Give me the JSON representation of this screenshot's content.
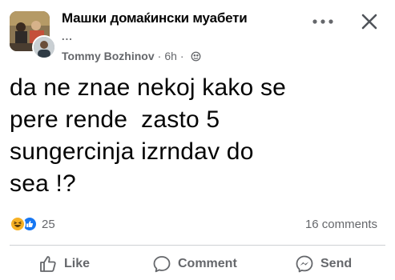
{
  "header": {
    "group_name": "Машки домаќински муабети",
    "group_name_overflow": "...",
    "author": "Tommy Bozhinov",
    "separator": "·",
    "time": "6h",
    "separator2": "·",
    "privacy_icon": "globe-icon",
    "more_icon": "more-icon",
    "close_icon": "close-icon"
  },
  "post": {
    "text": "da ne znae nekoj kako se\npere rende  zasto 5\nsungercinja izrndav do\nsea !?"
  },
  "engagement": {
    "reactions": [
      "haha-reaction-icon",
      "like-reaction-icon"
    ],
    "reaction_count": "25",
    "comments": "16 comments"
  },
  "actions": {
    "like": "Like",
    "comment": "Comment",
    "send": "Send"
  },
  "colors": {
    "text": "#050505",
    "secondary": "#65676b",
    "like_blue": "#1877f2",
    "haha_yellow": "#f7b125",
    "divider": "#ced0d4"
  }
}
